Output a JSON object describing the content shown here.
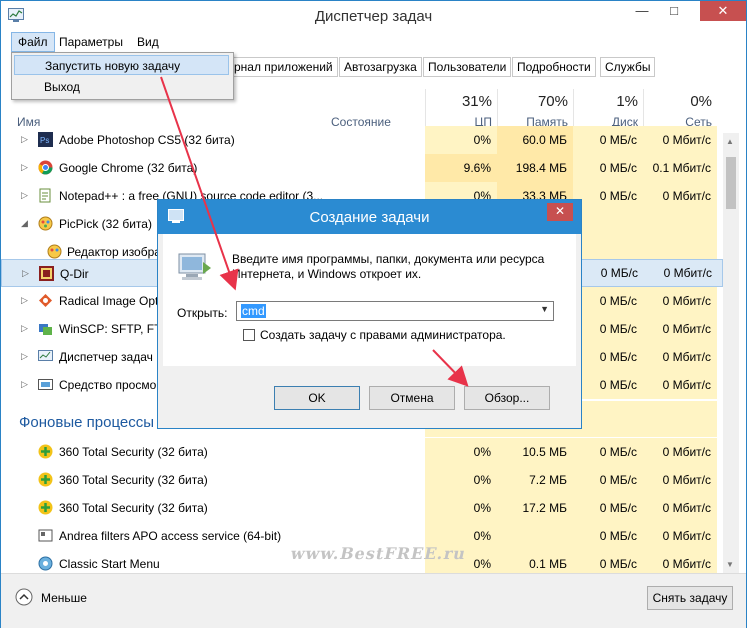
{
  "window": {
    "title": "Диспетчер задач",
    "minimize": "—",
    "maximize": "□",
    "close": "✕"
  },
  "menu": {
    "file": "Файл",
    "params": "Параметры",
    "view": "Вид",
    "dropdown": [
      {
        "label": "Запустить новую задачу"
      },
      {
        "label": "Выход"
      }
    ]
  },
  "tabs": [
    {
      "label": "рнал приложений"
    },
    {
      "label": "Автозагрузка"
    },
    {
      "label": "Пользователи"
    },
    {
      "label": "Подробности"
    },
    {
      "label": "Службы"
    }
  ],
  "columns": {
    "name": "Имя",
    "status": "Состояние",
    "cpu": {
      "percent": "31%",
      "label": "ЦП"
    },
    "mem": {
      "percent": "70%",
      "label": "Память"
    },
    "disk": {
      "percent": "1%",
      "label": "Диск"
    },
    "net": {
      "percent": "0%",
      "label": "Сеть"
    }
  },
  "processes": [
    {
      "name": "Adobe Photoshop CS5 (32 бита)",
      "expand": "▷",
      "cpu": "0%",
      "mem": "60.0 МБ",
      "disk": "0 МБ/с",
      "net": "0 Мбит/с"
    },
    {
      "name": "Google Chrome (32 бита)",
      "expand": "▷",
      "cpu": "9.6%",
      "mem": "198.4 МБ",
      "disk": "0 МБ/с",
      "net": "0.1 Мбит/с"
    },
    {
      "name": "Notepad++ : a free (GNU) source code editor (3...",
      "expand": "▷",
      "cpu": "0%",
      "mem": "33.3 МБ",
      "disk": "0 МБ/с",
      "net": "0 Мбит/с"
    },
    {
      "name": "PicPick (32 бита)",
      "expand": "◢",
      "cpu": "",
      "mem": "",
      "disk": "",
      "net": ""
    },
    {
      "name": "Редактор изобра",
      "expand": "",
      "cpu": "",
      "mem": "",
      "disk": "",
      "net": ""
    },
    {
      "name": "Q-Dir",
      "expand": "▷",
      "cpu": "",
      "mem": "",
      "disk": "0 МБ/с",
      "net": "0 Мбит/с"
    },
    {
      "name": "Radical Image Opt",
      "expand": "▷",
      "cpu": "",
      "mem": "",
      "disk": "0 МБ/с",
      "net": "0 Мбит/с"
    },
    {
      "name": "WinSCP: SFTP, FTP",
      "expand": "▷",
      "cpu": "",
      "mem": "",
      "disk": "0 МБ/с",
      "net": "0 Мбит/с"
    },
    {
      "name": "Диспетчер задач",
      "expand": "▷",
      "cpu": "",
      "mem": "",
      "disk": "0 МБ/с",
      "net": "0 Мбит/с"
    },
    {
      "name": "Средство просмо",
      "expand": "▷",
      "cpu": "",
      "mem": "",
      "disk": "0 МБ/с",
      "net": "0 Мбит/с"
    }
  ],
  "background_group": "Фоновые процессы",
  "bg_processes": [
    {
      "name": "360 Total Security (32 бита)",
      "cpu": "0%",
      "mem": "10.5 МБ",
      "disk": "0 МБ/с",
      "net": "0 Мбит/с"
    },
    {
      "name": "360 Total Security (32 бита)",
      "cpu": "0%",
      "mem": "7.2 МБ",
      "disk": "0 МБ/с",
      "net": "0 Мбит/с"
    },
    {
      "name": "360 Total Security (32 бита)",
      "cpu": "0%",
      "mem": "17.2 МБ",
      "disk": "0 МБ/с",
      "net": "0 Мбит/с"
    },
    {
      "name": "Andrea filters APO access service (64-bit)",
      "cpu": "0%",
      "mem": "",
      "disk": "0 МБ/с",
      "net": "0 Мбит/с"
    },
    {
      "name": "Classic Start Menu",
      "cpu": "0%",
      "mem": "0.1 МБ",
      "disk": "0 МБ/с",
      "net": "0 Мбит/с"
    }
  ],
  "footer": {
    "less": "Меньше",
    "end_task": "Снять задачу"
  },
  "dialog": {
    "title": "Создание задачи",
    "close": "✕",
    "description": "Введите имя программы, папки, документа или ресурса Интернета, и Windows откроет их.",
    "open_label": "Открыть:",
    "input_value": "cmd",
    "admin_checkbox": "Создать задачу с правами администратора.",
    "ok": "OK",
    "cancel": "Отмена",
    "browse": "Обзор..."
  },
  "watermark": "www.BestFREE.ru",
  "colors": {
    "accent": "#2b8bd2",
    "arrow": "#e8334a",
    "highlight_yellow": "#fff4c4"
  }
}
